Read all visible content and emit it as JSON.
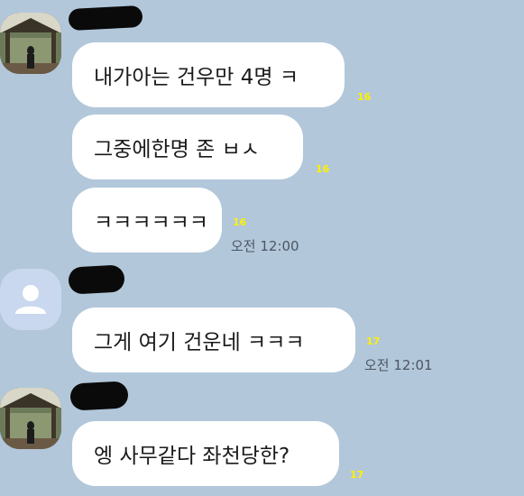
{
  "messages": [
    {
      "text": "내가아는 건우만 4명 ㅋ",
      "unread": "16",
      "time": ""
    },
    {
      "text": "그중에한명 존 ㅂㅅ",
      "unread": "16",
      "time": ""
    },
    {
      "text": "ㅋㅋㅋㅋㅋㅋ",
      "unread": "16",
      "time": "오전 12:00"
    },
    {
      "text": "그게 여기 건운네 ㅋㅋㅋ",
      "unread": "17",
      "time": "오전 12:01"
    },
    {
      "text": "엥 사무같다 좌천당한?",
      "unread": "17",
      "time": ""
    }
  ],
  "avatars": [
    {
      "icon": "profile-photo-icon"
    },
    {
      "icon": "default-person-icon"
    },
    {
      "icon": "profile-photo-icon"
    }
  ],
  "colors": {
    "background": "#b2c7da",
    "bubble": "#ffffff",
    "unread": "#fff100",
    "redaction": "#0a0a0a"
  }
}
